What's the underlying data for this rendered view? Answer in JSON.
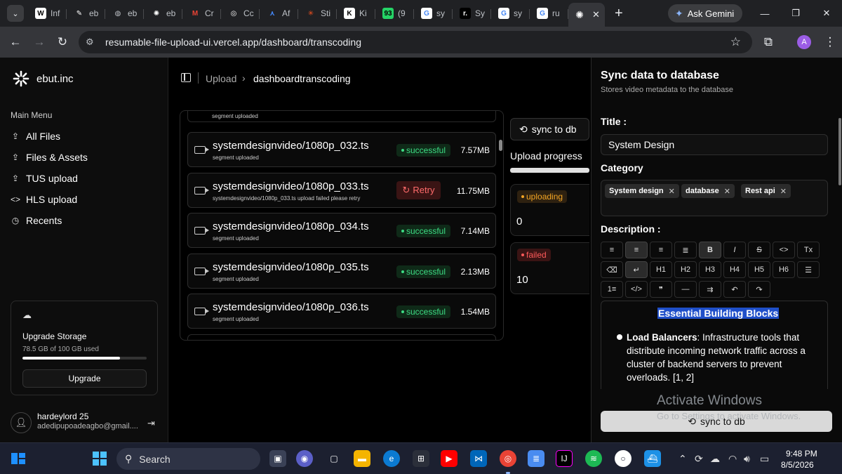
{
  "browser": {
    "tabs": [
      {
        "label": "Inf",
        "icon": "wikipedia-icon",
        "fav": "W",
        "color": "#ffffff",
        "bg": "#ffffff",
        "fg": "#000000"
      },
      {
        "label": "eb",
        "icon": "tool-icon",
        "fav": "✎",
        "color": "#ffffff",
        "bg": "#202124",
        "fg": "#ffffff"
      },
      {
        "label": "eb",
        "icon": "globe-icon",
        "fav": "◍",
        "color": "#bdc1c6",
        "bg": "#202124",
        "fg": "#bdc1c6"
      },
      {
        "label": "eb",
        "icon": "ebut-logo-icon",
        "fav": "✺",
        "color": "#ffffff",
        "bg": "#202124",
        "fg": "#ffffff"
      },
      {
        "label": "Cr",
        "icon": "gmail-icon",
        "fav": "M",
        "color": "#ea4335",
        "bg": "#202124",
        "fg": "#ea4335"
      },
      {
        "label": "Cc",
        "icon": "openai-icon",
        "fav": "◎",
        "color": "#ffffff",
        "bg": "#202124",
        "fg": "#ffffff"
      },
      {
        "label": "Af",
        "icon": "arrow-logo-icon",
        "fav": "⋏",
        "color": "#4285f4",
        "bg": "#202124",
        "fg": "#4285f4"
      },
      {
        "label": "Sti",
        "icon": "starburst-icon",
        "fav": "✳",
        "color": "#f4511e",
        "bg": "#202124",
        "fg": "#f4511e"
      },
      {
        "label": "Ki",
        "icon": "kick-icon",
        "fav": "K",
        "color": "#000000",
        "bg": "#ffffff",
        "fg": "#000000"
      },
      {
        "label": "(9",
        "icon": "whatsapp-icon",
        "fav": "93",
        "color": "#ffffff",
        "bg": "#25d366",
        "fg": "#000000"
      },
      {
        "label": "sy",
        "icon": "google-icon",
        "fav": "G",
        "color": "#4285f4",
        "bg": "#ffffff",
        "fg": "#4285f4"
      },
      {
        "label": "Sy",
        "icon": "notion-icon",
        "fav": "r.",
        "color": "#ffffff",
        "bg": "#000000",
        "fg": "#ffffff"
      },
      {
        "label": "sy",
        "icon": "google-icon",
        "fav": "G",
        "color": "#4285f4",
        "bg": "#ffffff",
        "fg": "#4285f4"
      },
      {
        "label": "ru",
        "icon": "google-icon",
        "fav": "G",
        "color": "#4285f4",
        "bg": "#ffffff",
        "fg": "#4285f4"
      }
    ],
    "active_tab_close": "✕",
    "new_tab": "+",
    "gemini_label": "Ask Gemini",
    "url": "resumable-file-upload-ui.vercel.app/dashboard/transcoding",
    "profile_initial": "A"
  },
  "sidebar": {
    "brand": "ebut.inc",
    "menu_label": "Main Menu",
    "items": [
      {
        "label": "All Files",
        "icon": "file-upload-icon",
        "glyph": "⇪"
      },
      {
        "label": "Files & Assets",
        "icon": "file-upload-icon",
        "glyph": "⇪"
      },
      {
        "label": "TUS upload",
        "icon": "file-upload-icon",
        "glyph": "⇪"
      },
      {
        "label": "HLS upload",
        "icon": "code-icon",
        "glyph": "<>"
      },
      {
        "label": "Recents",
        "icon": "clock-icon",
        "glyph": "◷"
      }
    ],
    "storage": {
      "title": "Upgrade Storage",
      "used": "78.5 GB of 100 GB used",
      "used_fraction": 0.785,
      "button": "Upgrade"
    },
    "user": {
      "name": "hardeylord 25",
      "email": "adedipupoadeagbo@gmail...."
    }
  },
  "header": {
    "crumb_root": "Upload",
    "crumb_sep": "›",
    "crumb_current": "dashboardtranscoding"
  },
  "files": {
    "top_partial_sub": "segment uploaded",
    "rows": [
      {
        "name": "systemdesignvideo/1080p_032.ts",
        "sub": "segment uploaded",
        "status": "successful",
        "size": "7.57MB"
      },
      {
        "name": "systemdesignvideo/1080p_033.ts",
        "sub": "systemdesignvideo/1080p_033.ts upload failed please retry",
        "status": "Retry",
        "size": "11.75MB"
      },
      {
        "name": "systemdesignvideo/1080p_034.ts",
        "sub": "segment uploaded",
        "status": "successful",
        "size": "7.14MB"
      },
      {
        "name": "systemdesignvideo/1080p_035.ts",
        "sub": "segment uploaded",
        "status": "successful",
        "size": "2.13MB"
      },
      {
        "name": "systemdesignvideo/1080p_036.ts",
        "sub": "segment uploaded",
        "status": "successful",
        "size": "1.54MB"
      }
    ]
  },
  "progress": {
    "sync_label": "sync to db",
    "title": "Upload progress",
    "fraction": 1.0,
    "uploading_label": "uploading",
    "uploading_value": "0",
    "failed_label": "failed",
    "failed_value": "10",
    "uploading_color": "#f5a623",
    "failed_color": "#ff5a5a"
  },
  "sheet": {
    "title": "Sync data to database",
    "description": "Stores video metadata to the database",
    "title_label": "Title :",
    "title_value": "System Design",
    "category_label": "Category",
    "categories": [
      "System design",
      "database",
      "Rest api"
    ],
    "chip_remove": "✕",
    "description_label": "Description :",
    "toolbar_rows": [
      [
        {
          "glyph": "≡",
          "name": "align-left-icon",
          "on": false
        },
        {
          "glyph": "≡",
          "name": "align-center-icon",
          "on": true
        },
        {
          "glyph": "≡",
          "name": "align-right-icon",
          "on": false
        },
        {
          "glyph": "≣",
          "name": "align-justify-icon",
          "on": false
        },
        {
          "glyph": "B",
          "name": "bold-icon",
          "on": true
        },
        {
          "glyph": "I",
          "name": "italic-icon",
          "on": false
        },
        {
          "glyph": "S",
          "name": "strikethrough-icon",
          "on": false
        },
        {
          "glyph": "<>",
          "name": "inline-code-icon",
          "on": false
        },
        {
          "glyph": "Tx",
          "name": "clear-format-icon",
          "on": false
        }
      ],
      [
        {
          "glyph": "⌫",
          "name": "eraser-icon",
          "on": false
        },
        {
          "glyph": "↵",
          "name": "hard-break-icon",
          "on": true
        },
        {
          "glyph": "H1",
          "name": "heading-1-icon",
          "on": false
        },
        {
          "glyph": "H2",
          "name": "heading-2-icon",
          "on": false
        },
        {
          "glyph": "H3",
          "name": "heading-3-icon",
          "on": false
        },
        {
          "glyph": "H4",
          "name": "heading-4-icon",
          "on": false
        },
        {
          "glyph": "H5",
          "name": "heading-5-icon",
          "on": false
        },
        {
          "glyph": "H6",
          "name": "heading-6-icon",
          "on": false
        },
        {
          "glyph": "☰",
          "name": "bullet-list-icon",
          "on": false
        }
      ],
      [
        {
          "glyph": "1≡",
          "name": "ordered-list-icon",
          "on": false
        },
        {
          "glyph": "</>",
          "name": "code-block-icon",
          "on": false
        },
        {
          "glyph": "❞",
          "name": "blockquote-icon",
          "on": false
        },
        {
          "glyph": "—",
          "name": "horizontal-rule-icon",
          "on": false
        },
        {
          "glyph": "⇉",
          "name": "wrap-text-icon",
          "on": false
        },
        {
          "glyph": "↶",
          "name": "undo-icon",
          "on": false
        },
        {
          "glyph": "↷",
          "name": "redo-icon",
          "on": false
        }
      ]
    ],
    "editor_heading": "Essential Building Blocks",
    "editor_bold": "Load Balancers",
    "editor_text": ": Infrastructure tools that distribute incoming network traffic across a cluster of backend servers to prevent overloads. [1, 2]",
    "sync_button": "sync to db"
  },
  "watermark": {
    "line1": "Activate Windows",
    "line2": "Go to Settings to activate Windows."
  },
  "taskbar": {
    "search": "Search",
    "time": "9:48 PM",
    "date": "8/5/2026"
  }
}
